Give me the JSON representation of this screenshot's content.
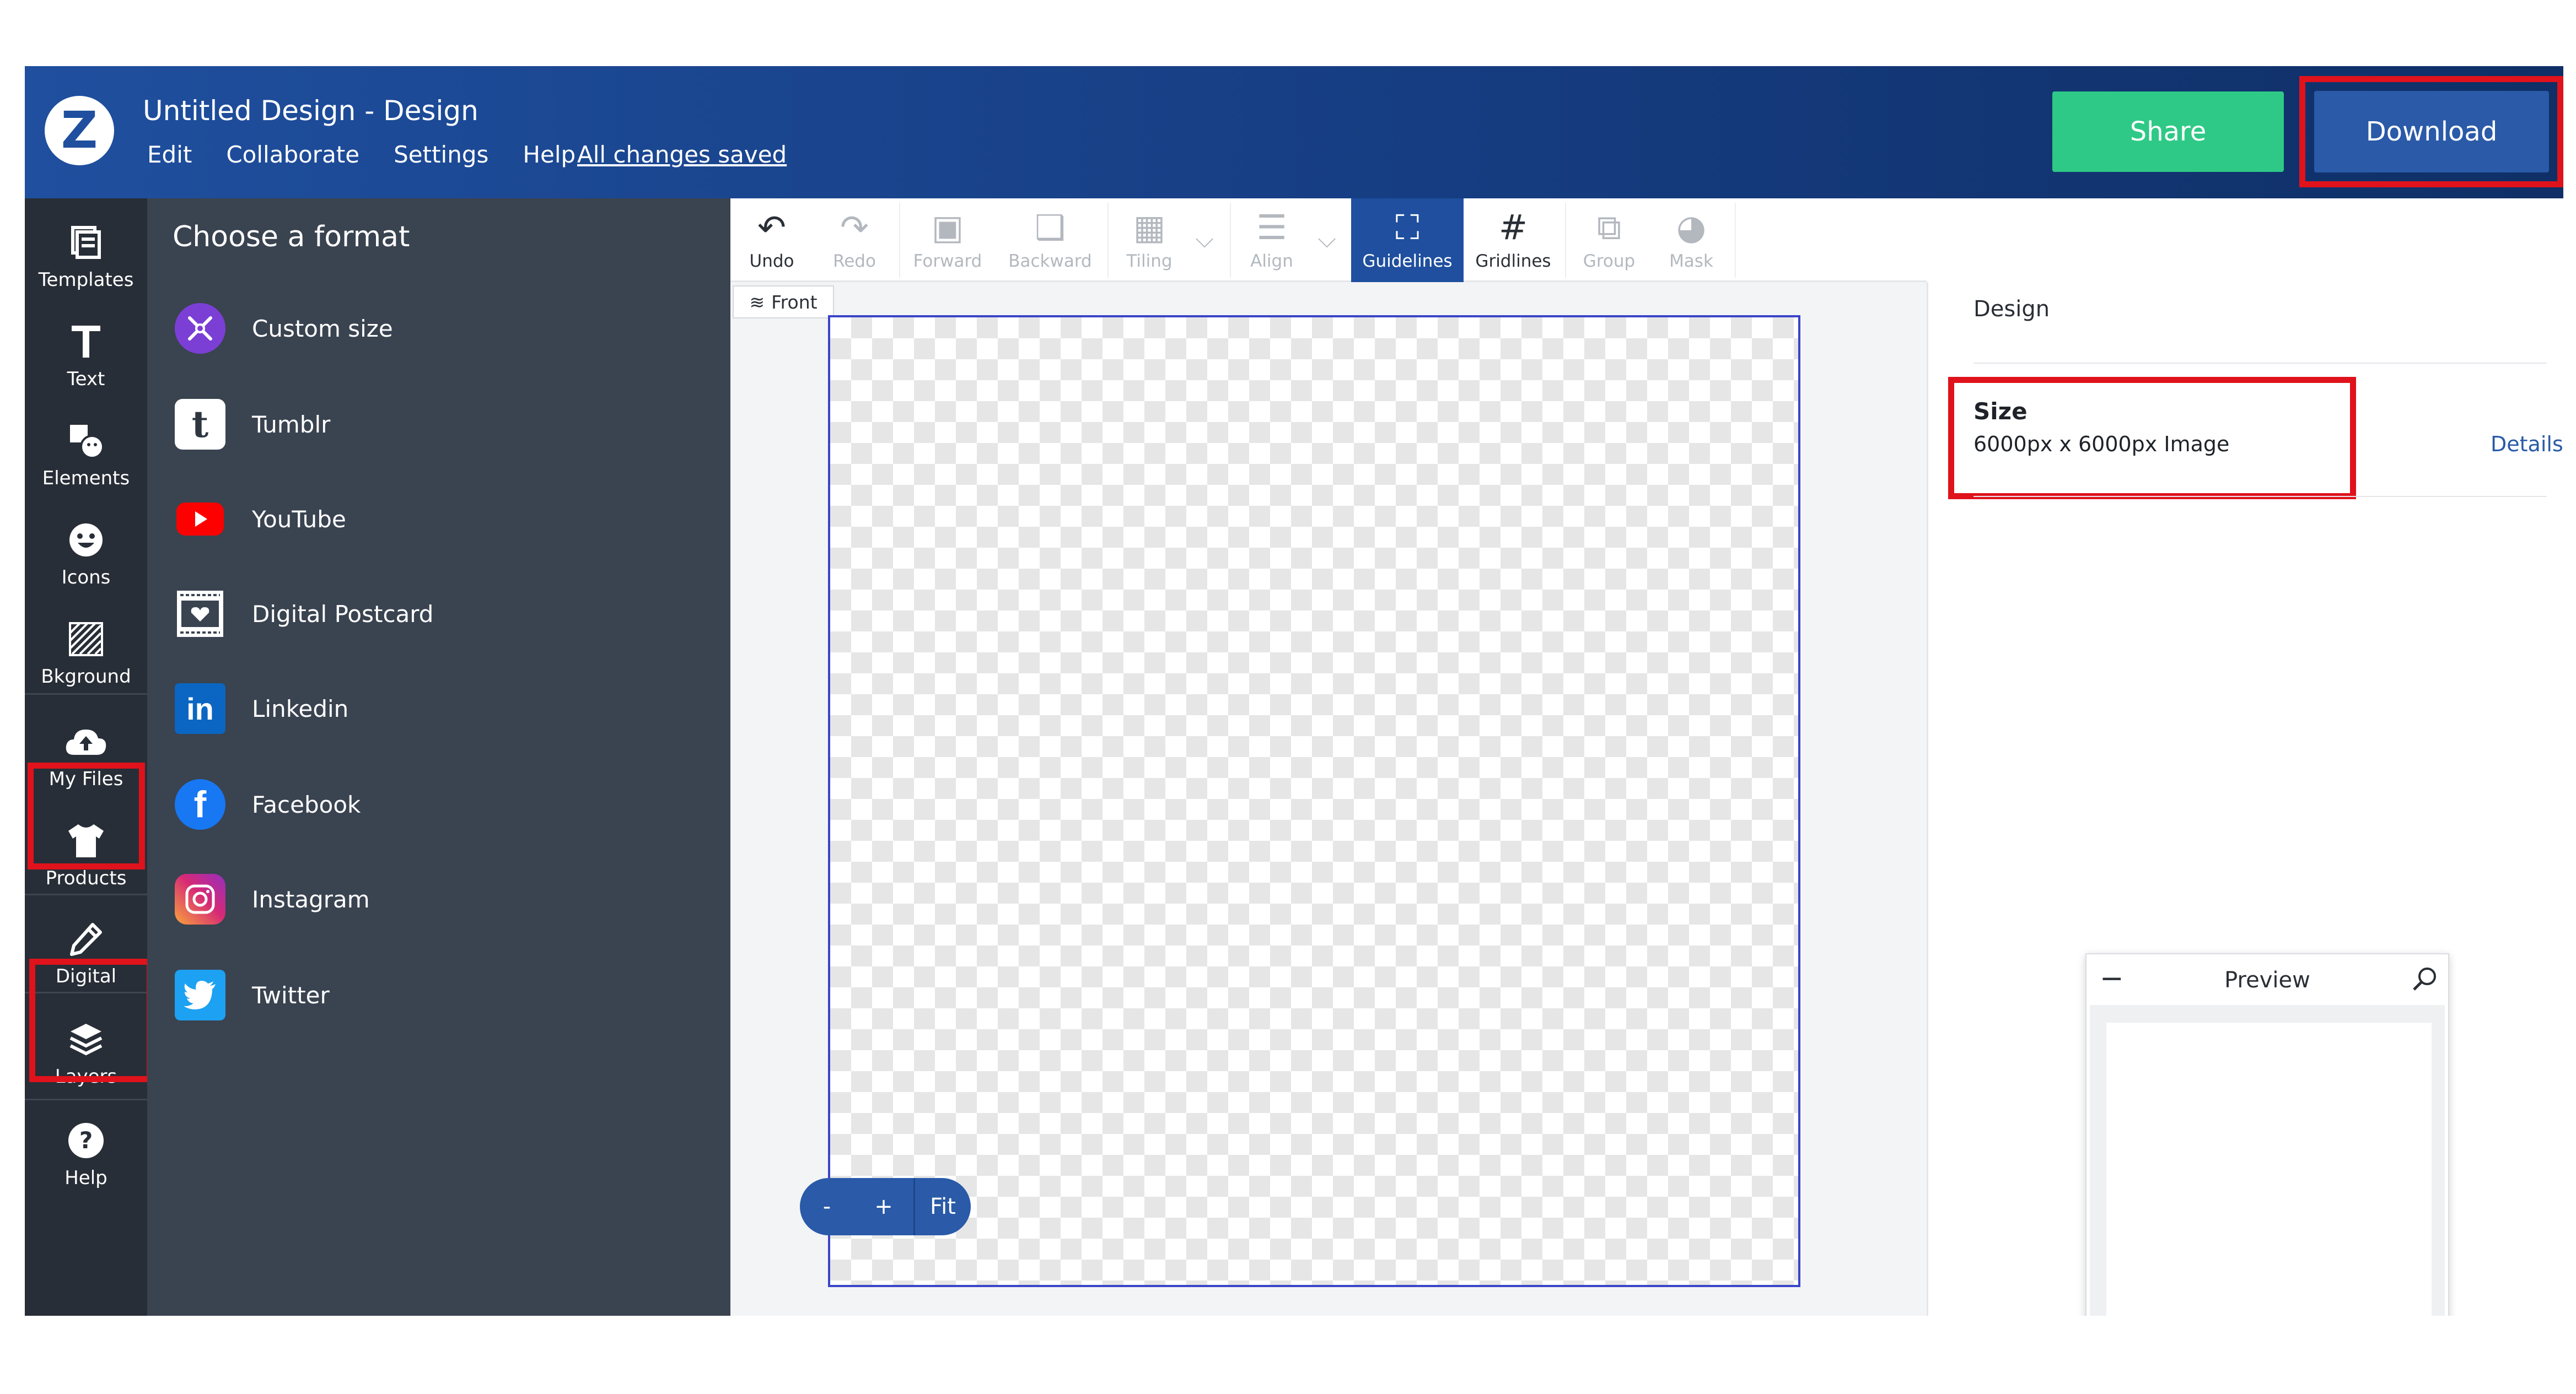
{
  "header": {
    "logo_letter": "Z",
    "design_title": "Untitled Design - Design",
    "menu": [
      "Edit",
      "Collaborate",
      "Settings",
      "Help"
    ],
    "save_status": "All changes saved",
    "share_label": "Share",
    "download_label": "Download"
  },
  "rail": {
    "items": [
      {
        "label": "Templates",
        "icon": "templates-icon"
      },
      {
        "label": "Text",
        "icon": "text-icon"
      },
      {
        "label": "Elements",
        "icon": "elements-icon"
      },
      {
        "label": "Icons",
        "icon": "smiley-icon"
      },
      {
        "label": "Bkground",
        "icon": "background-icon"
      },
      {
        "label": "My Files",
        "icon": "cloud-upload-icon"
      },
      {
        "label": "Products",
        "icon": "tshirt-icon"
      },
      {
        "label": "Digital",
        "icon": "pencil-icon"
      },
      {
        "label": "Layers",
        "icon": "layers-icon"
      },
      {
        "label": "Help",
        "icon": "help-icon"
      }
    ]
  },
  "formats": {
    "title": "Choose a format",
    "items": [
      {
        "label": "Custom size",
        "icon": "custom-size-icon",
        "color": "#7b3fd6"
      },
      {
        "label": "Tumblr",
        "icon": "tumblr-icon",
        "color": "#ffffff"
      },
      {
        "label": "YouTube",
        "icon": "youtube-icon",
        "color": "#ff0000"
      },
      {
        "label": "Digital Postcard",
        "icon": "postcard-icon",
        "color": "#ffffff"
      },
      {
        "label": "Linkedin",
        "icon": "linkedin-icon",
        "color": "#0a66c2"
      },
      {
        "label": "Facebook",
        "icon": "facebook-icon",
        "color": "#1877f2"
      },
      {
        "label": "Instagram",
        "icon": "instagram-icon",
        "color": "#d62976"
      },
      {
        "label": "Twitter",
        "icon": "twitter-icon",
        "color": "#1da1f2"
      }
    ]
  },
  "toolbar": {
    "undo": "Undo",
    "redo": "Redo",
    "forward": "Forward",
    "backward": "Backward",
    "tiling": "Tiling",
    "align": "Align",
    "guidelines": "Guidelines",
    "gridlines": "Gridlines",
    "group": "Group",
    "mask": "Mask"
  },
  "canvas": {
    "side_tab": "Front",
    "zoom_out": "-",
    "zoom_in": "+",
    "zoom_fit": "Fit"
  },
  "right_panel": {
    "title": "Design",
    "size_label": "Size",
    "size_value": "6000px x 6000px Image",
    "details_link": "Details ▸"
  },
  "preview": {
    "title": "Preview",
    "minimize": "−"
  },
  "colors": {
    "brand_blue": "#1f4f9e",
    "share_green": "#2ec986",
    "highlight_red": "#e0121b",
    "panel_dark": "#3a4350",
    "rail_dark": "#282e37"
  }
}
